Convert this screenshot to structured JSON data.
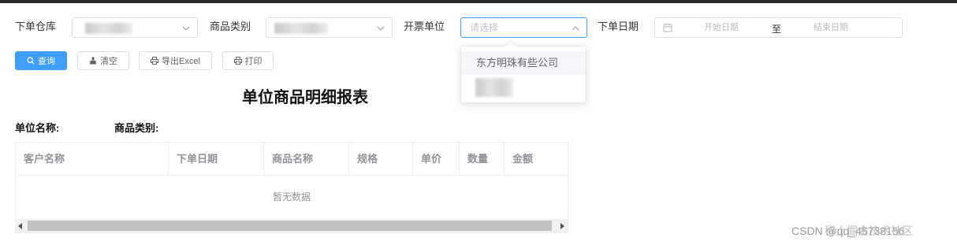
{
  "filters": {
    "warehouse_label": "下单仓库",
    "category_label": "商品类别",
    "invoice_unit_label": "开票单位",
    "invoice_unit_placeholder": "请选择",
    "order_date_label": "下单日期",
    "start_date_placeholder": "开始日期",
    "range_separator": "至",
    "end_date_placeholder": "结束日期"
  },
  "buttons": {
    "query": "查询",
    "clear": "清空",
    "export": "导出Excel",
    "print": "打印"
  },
  "dropdown": {
    "options": [
      "东方明珠有些公司"
    ]
  },
  "report": {
    "title": "单位商品明细报表",
    "unit_name_label": "单位名称:",
    "category_label": "商品类别:"
  },
  "table": {
    "columns": [
      "客户名称",
      "下单日期",
      "商品名称",
      "规格",
      "单价",
      "数量",
      "金额"
    ],
    "empty_text": "暂无数据"
  },
  "watermark": {
    "text": "CSDN @qq_45738156",
    "overlay": "稀土掘金技术社区"
  },
  "colors": {
    "primary": "#409eff",
    "border": "#dcdfe6",
    "header_text": "#909399"
  }
}
